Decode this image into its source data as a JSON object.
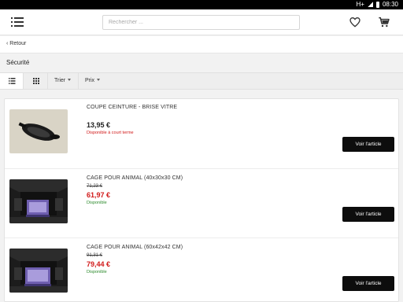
{
  "status_bar": {
    "network": "H+",
    "time": "08:30"
  },
  "header": {
    "search_placeholder": "Rechercher ..."
  },
  "nav": {
    "back_label": "Retour"
  },
  "category": {
    "title": "Sécurité"
  },
  "toolbar": {
    "sort_label": "Trier",
    "price_label": "Prix"
  },
  "products": [
    {
      "title": "COUPE CEINTURE - BRISE VITRE",
      "old_price": "",
      "price": "13,95 €",
      "price_color": "#222222",
      "availability": "Disponible à court terme",
      "availability_color": "#d11a1a",
      "button_label": "Voir l'article",
      "image_icon": "seatbelt-cutter-photo"
    },
    {
      "title": "CAGE POUR ANIMAL (40x30x30 CM)",
      "old_price": "71,23 €",
      "price": "61,97 €",
      "price_color": "#d11a1a",
      "availability": "Disponible",
      "availability_color": "#2e8b2e",
      "button_label": "Voir l'article",
      "image_icon": "pet-cage-in-trunk-photo"
    },
    {
      "title": "CAGE POUR ANIMAL (60x42x42 CM)",
      "old_price": "91,31 €",
      "price": "79,44 €",
      "price_color": "#d11a1a",
      "availability": "Disponible",
      "availability_color": "#2e8b2e",
      "button_label": "Voir l'article",
      "image_icon": "pet-cage-in-trunk-photo"
    }
  ]
}
